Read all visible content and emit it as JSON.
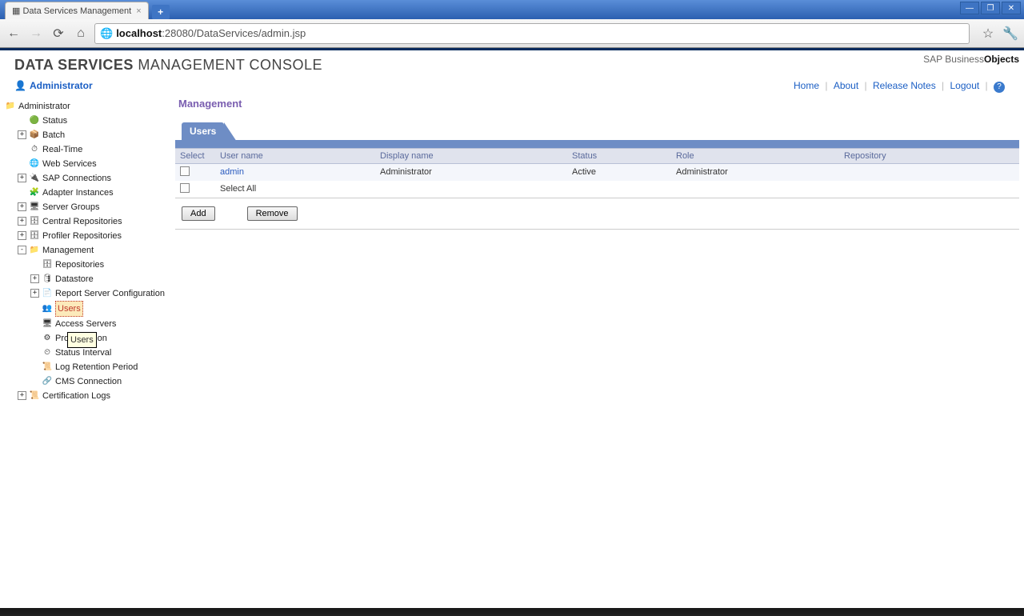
{
  "browser": {
    "tab_title": "Data Services Management",
    "url_host": "localhost",
    "url_port": ":28080",
    "url_path": "/DataServices/admin.jsp"
  },
  "header": {
    "title_strong": "DATA SERVICES",
    "title_rest": " MANAGEMENT CONSOLE",
    "brand_prefix": "SAP Business",
    "brand_suffix": "Objects",
    "admin_label": "Administrator",
    "links": {
      "home": "Home",
      "about": "About",
      "release_notes": "Release Notes",
      "logout": "Logout"
    }
  },
  "sidebar": {
    "root": "Administrator",
    "items": {
      "status": "Status",
      "batch": "Batch",
      "realtime": "Real-Time",
      "webservices": "Web Services",
      "sapconn": "SAP Connections",
      "adapter": "Adapter Instances",
      "servergroups": "Server Groups",
      "centralrepo": "Central Repositories",
      "profilerrepo": "Profiler Repositories",
      "management": "Management",
      "certlogs": "Certification Logs"
    },
    "mgmt": {
      "repositories": "Repositories",
      "datastore": "Datastore",
      "reportserver": "Report Server Configuration",
      "users": "Users",
      "accessservers": "Access Servers",
      "profilerconfig": "Profiler Configuration",
      "statusinterval": "Status Interval",
      "logretention": "Log Retention Period",
      "cmsconnection": "CMS Connection"
    },
    "tooltip": "Users"
  },
  "panel": {
    "title": "Management",
    "tab": "Users",
    "columns": {
      "select": "Select",
      "username": "User name",
      "displayname": "Display name",
      "status": "Status",
      "role": "Role",
      "repository": "Repository"
    },
    "rows": [
      {
        "username": "admin",
        "displayname": "Administrator",
        "status": "Active",
        "role": "Administrator",
        "repository": ""
      }
    ],
    "select_all": "Select All",
    "buttons": {
      "add": "Add",
      "remove": "Remove"
    }
  }
}
